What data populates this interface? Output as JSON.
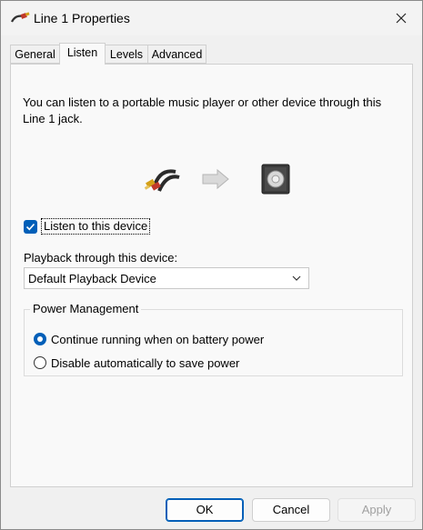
{
  "window": {
    "title": "Line 1 Properties",
    "icon": "audio-cable-icon"
  },
  "tabs": [
    {
      "label": "General",
      "active": false
    },
    {
      "label": "Listen",
      "active": true
    },
    {
      "label": "Levels",
      "active": false
    },
    {
      "label": "Advanced",
      "active": false
    }
  ],
  "listen": {
    "description": "You can listen to a portable music player or other device through this Line 1 jack.",
    "listen_checkbox_label": "Listen to this device",
    "listen_checked": true,
    "playback_label": "Playback through this device:",
    "playback_selected": "Default Playback Device"
  },
  "power": {
    "legend": "Power Management",
    "options": [
      {
        "label": "Continue running when on battery power",
        "selected": true
      },
      {
        "label": "Disable automatically to save power",
        "selected": false
      }
    ]
  },
  "buttons": {
    "ok": "OK",
    "cancel": "Cancel",
    "apply": "Apply"
  },
  "colors": {
    "accent": "#005fb8"
  }
}
